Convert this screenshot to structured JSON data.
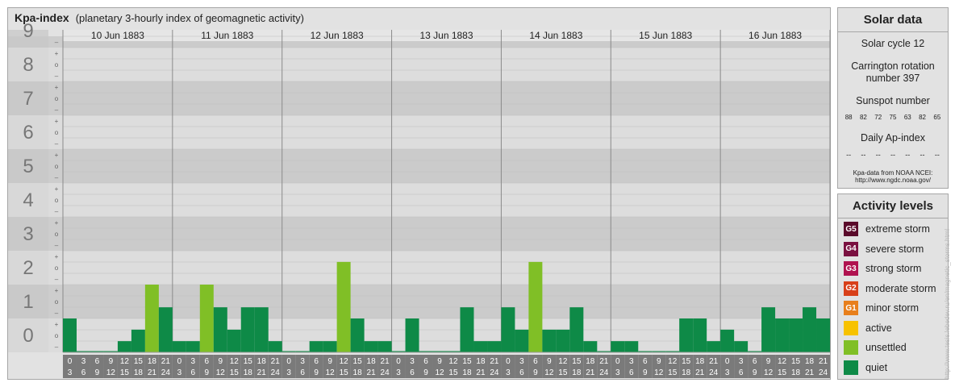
{
  "header": {
    "title": "Kpa-index",
    "subtitle": "(planetary 3-hourly index of geomagnetic activity)"
  },
  "chart_data": {
    "type": "bar",
    "days": [
      "10 Jun 1883",
      "11 Jun 1883",
      "12 Jun 1883",
      "13 Jun 1883",
      "14 Jun 1883",
      "15 Jun 1883",
      "16 Jun 1883"
    ],
    "y_ticks": [
      "0",
      "1",
      "2",
      "3",
      "4",
      "5",
      "6",
      "7",
      "8",
      "9"
    ],
    "thirds_labels": [
      "–",
      "o",
      "+"
    ],
    "interval_labels": [
      [
        "0",
        "3"
      ],
      [
        "3",
        "6"
      ],
      [
        "6",
        "9"
      ],
      [
        "9",
        "12"
      ],
      [
        "12",
        "15"
      ],
      [
        "15",
        "18"
      ],
      [
        "18",
        "21"
      ],
      [
        "21",
        "24"
      ]
    ],
    "ylim": [
      0,
      9.33
    ],
    "values": [
      1.0,
      0,
      0,
      0,
      0.33,
      0.67,
      2.0,
      1.33,
      0.33,
      0.33,
      2.0,
      1.33,
      0.67,
      1.33,
      1.33,
      0.33,
      0,
      0,
      0.33,
      0.33,
      2.67,
      1.0,
      0.33,
      0.33,
      0,
      1.0,
      0,
      0,
      0,
      1.33,
      0.33,
      0.33,
      1.33,
      0.67,
      2.67,
      0.67,
      0.67,
      1.33,
      0.33,
      0,
      0.33,
      0.33,
      0,
      0,
      0,
      1.0,
      1.0,
      0.33,
      0.67,
      0.33,
      0,
      1.33,
      1.0,
      1.0,
      1.33,
      1.0
    ],
    "colors": {
      "quiet": "#0e8a47",
      "unsettled": "#80bf26"
    },
    "unsettled_threshold": 2
  },
  "solar": {
    "title": "Solar data",
    "cycle": "Solar cycle 12",
    "carrington_line1": "Carrington rotation",
    "carrington_line2": "number 397",
    "sunspot_title": "Sunspot number",
    "sunspots": [
      "88",
      "82",
      "72",
      "75",
      "63",
      "82",
      "65"
    ],
    "ap_title": "Daily Ap-index",
    "ap_values": [
      "--",
      "--",
      "--",
      "--",
      "--",
      "--",
      "--"
    ],
    "source_line1": "Kpa-data from NOAA NCEI:",
    "source_line2": "http://www.ngdc.noaa.gov/"
  },
  "activity": {
    "title": "Activity levels",
    "levels": [
      {
        "badge": "G5",
        "label": "extreme storm",
        "color": "#5a0a2a"
      },
      {
        "badge": "G4",
        "label": "severe storm",
        "color": "#7a1040"
      },
      {
        "badge": "G3",
        "label": "strong storm",
        "color": "#b0124f"
      },
      {
        "badge": "G2",
        "label": "moderate storm",
        "color": "#d8401a"
      },
      {
        "badge": "G1",
        "label": "minor storm",
        "color": "#e87f1c"
      },
      {
        "badge": "",
        "label": "active",
        "color": "#f7c200"
      },
      {
        "badge": "",
        "label": "unsettled",
        "color": "#80bf26"
      },
      {
        "badge": "",
        "label": "quiet",
        "color": "#0e8a47"
      }
    ]
  },
  "watermark": "http://www.tesis.lebedev.ru/en/magnetic_storms.html"
}
